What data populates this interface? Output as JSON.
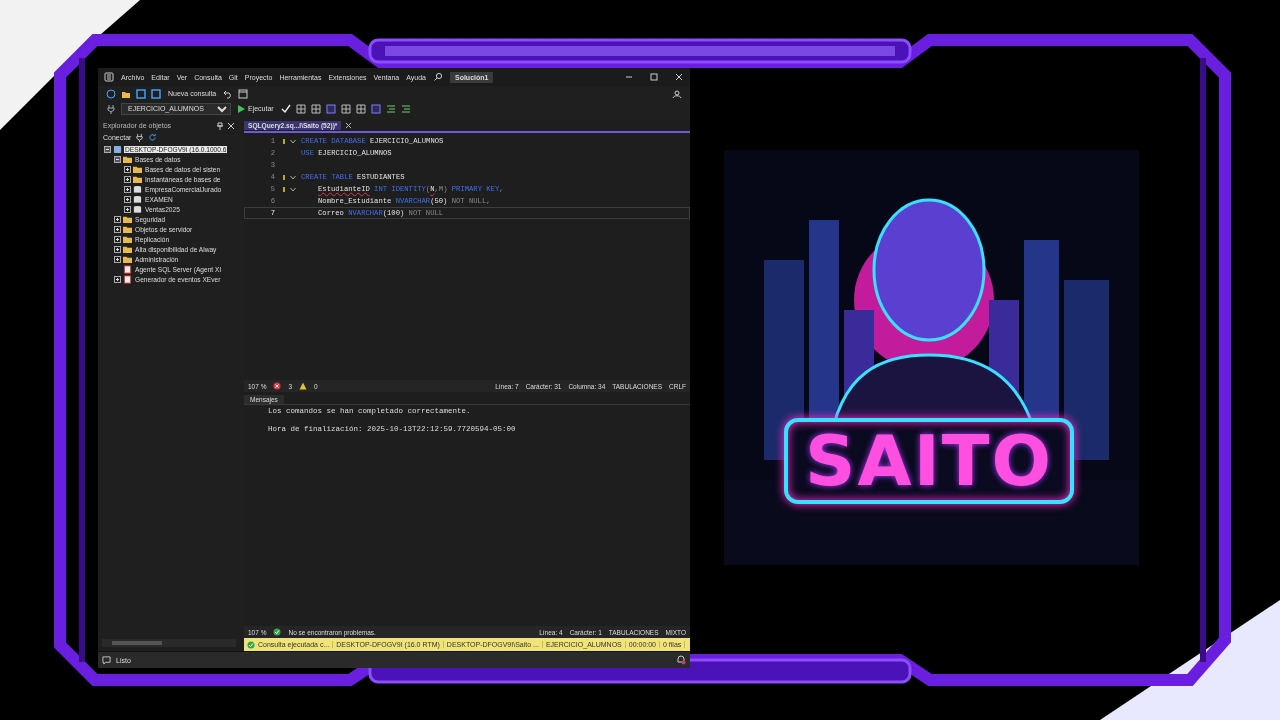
{
  "window": {
    "menu": [
      "Archivo",
      "Editar",
      "Ver",
      "Consulta",
      "Git",
      "Proyecto",
      "Herramientas",
      "Extensiones",
      "Ventana",
      "Ayuda"
    ],
    "solution": "Solución1"
  },
  "toolbar": {
    "new_query": "Nueva consulta",
    "database": "EJERCICIO_ALUMNOS",
    "execute": "Ejecutar"
  },
  "object_explorer": {
    "title": "Explorador de objetos",
    "connect": "Conectar",
    "tree": [
      {
        "label": "DESKTOP-DFOGV9I (16.0.1000.6",
        "kind": "server",
        "expanded": true,
        "selected": true,
        "children": [
          {
            "label": "Bases de datos",
            "kind": "folder",
            "expanded": true,
            "selected": false,
            "children": [
              {
                "label": "Bases de datos del sisten",
                "kind": "folder",
                "expanded": false,
                "selected": false
              },
              {
                "label": "Instantáneas de bases de",
                "kind": "folder",
                "expanded": false,
                "selected": false
              },
              {
                "label": "EmpresaComercialJurado",
                "kind": "database",
                "expanded": false,
                "selected": false
              },
              {
                "label": "EXAMEN",
                "kind": "database",
                "expanded": false,
                "selected": false
              },
              {
                "label": "Ventas2025",
                "kind": "database",
                "expanded": false,
                "selected": false
              }
            ]
          },
          {
            "label": "Seguridad",
            "kind": "folder",
            "expanded": false,
            "selected": false
          },
          {
            "label": "Objetos de servidor",
            "kind": "folder",
            "expanded": false,
            "selected": false
          },
          {
            "label": "Replicación",
            "kind": "folder",
            "expanded": false,
            "selected": false
          },
          {
            "label": "Alta disponibilidad de Alway",
            "kind": "folder",
            "expanded": false,
            "selected": false
          },
          {
            "label": "Administración",
            "kind": "folder",
            "expanded": false,
            "selected": false
          },
          {
            "label": "Agente SQL Server (Agent XI",
            "kind": "agent",
            "selected": false
          },
          {
            "label": "Generador de eventos XEver",
            "kind": "events",
            "expanded": false,
            "selected": false
          }
        ]
      }
    ]
  },
  "editor": {
    "tab": "SQLQuery2.sq...I\\Saito (52))*",
    "lines": [
      {
        "number": "1",
        "fold": true,
        "current": false,
        "indented": false,
        "tokens": [
          {
            "text": "CREATE DATABASE",
            "kind": "keyword"
          },
          {
            "text": " EJERCICIO_ALUMNOS",
            "kind": "plain"
          }
        ]
      },
      {
        "number": "2",
        "fold": false,
        "current": false,
        "indented": false,
        "tokens": [
          {
            "text": "USE",
            "kind": "keyword"
          },
          {
            "text": " EJERCICIO_ALUMNOS",
            "kind": "plain"
          }
        ]
      },
      {
        "number": "3",
        "fold": false,
        "current": false
      },
      {
        "number": "4",
        "fold": true,
        "current": false,
        "indented": false,
        "tokens": [
          {
            "text": "CREATE TABLE",
            "kind": "keyword"
          },
          {
            "text": " ESTUDIANTES",
            "kind": "plain"
          }
        ]
      },
      {
        "number": "5",
        "fold": true,
        "current": false,
        "indented": true,
        "tokens": [
          {
            "text": "EstudianteID",
            "kind": "error"
          },
          {
            "text": " INT IDENTITY",
            "kind": "keyword"
          },
          {
            "text": "(",
            "kind": "muted"
          },
          {
            "text": "N",
            "kind": "error"
          },
          {
            "text": ",M) ",
            "kind": "muted"
          },
          {
            "text": "PRIMARY KEY",
            "kind": "keyword"
          },
          {
            "text": ",",
            "kind": "muted"
          }
        ]
      },
      {
        "number": "6",
        "fold": false,
        "current": false,
        "indented": true,
        "tokens": [
          {
            "text": "Nombre_Estudiante ",
            "kind": "plain"
          },
          {
            "text": "NVARCHAR",
            "kind": "keyword"
          },
          {
            "text": "(50) ",
            "kind": "plain"
          },
          {
            "text": "NOT NULL,",
            "kind": "muted"
          }
        ]
      },
      {
        "number": "7",
        "fold": false,
        "current": true,
        "indented": true,
        "tokens": [
          {
            "text": "Correo ",
            "kind": "plain"
          },
          {
            "text": "NVARCHAR",
            "kind": "keyword"
          },
          {
            "text": "(100) ",
            "kind": "plain"
          },
          {
            "text": "NOT NULL",
            "kind": "muted"
          }
        ]
      }
    ],
    "status": {
      "zoom": "107 %",
      "errors": "3",
      "warnings": "0",
      "line": "Línea: 7",
      "char": "Carácter: 31",
      "column": "Columna: 34",
      "indent": "TABULACIONES",
      "eol": "CRLF"
    }
  },
  "messages": {
    "tab": "Mensajes",
    "lines": [
      "Los comandos se han completado correctamente.",
      "Hora de finalización: 2025-10-13T22:12:59.7720594-05:00"
    ],
    "status": {
      "zoom": "107 %",
      "message": "No se encontraron problemas.",
      "line": "Línea: 4",
      "char": "Carácter: 1",
      "indent": "TABULACIONES",
      "eol": "MIXTO"
    }
  },
  "query_status": [
    "Consulta ejecutada c...",
    "DESKTOP-DFOGV9I (16.0 RTM)",
    "DESKTOP-DFOGV9I\\Saito ...",
    "EJERCICIO_ALUMNOS",
    "00:00:00",
    "0 filas"
  ],
  "status_bar": {
    "text": "Listo"
  },
  "brand": {
    "kind": "picture",
    "logo": "SAITO"
  }
}
